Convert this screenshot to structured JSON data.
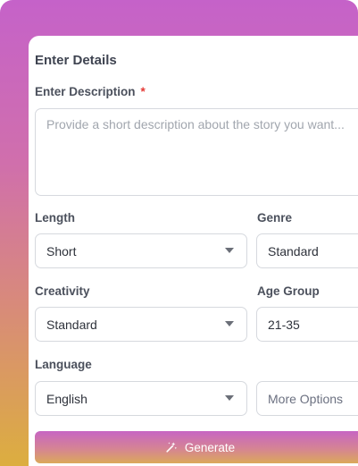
{
  "form": {
    "title": "Enter Details",
    "description": {
      "label": "Enter Description",
      "required_mark": "*",
      "placeholder": "Provide a short description about the story you want..."
    },
    "length": {
      "label": "Length",
      "value": "Short"
    },
    "genre": {
      "label": "Genre",
      "value": "Standard"
    },
    "creativity": {
      "label": "Creativity",
      "value": "Standard"
    },
    "age_group": {
      "label": "Age Group",
      "value": "21-35"
    },
    "language": {
      "label": "Language",
      "value": "English"
    },
    "more_options": {
      "label": "More Options"
    },
    "generate": {
      "label": "Generate",
      "icon": "magic-wand-icon"
    }
  },
  "colors": {
    "gradient_top": "#c562c9",
    "gradient_bottom": "#dcae3f",
    "required": "#e53935"
  }
}
